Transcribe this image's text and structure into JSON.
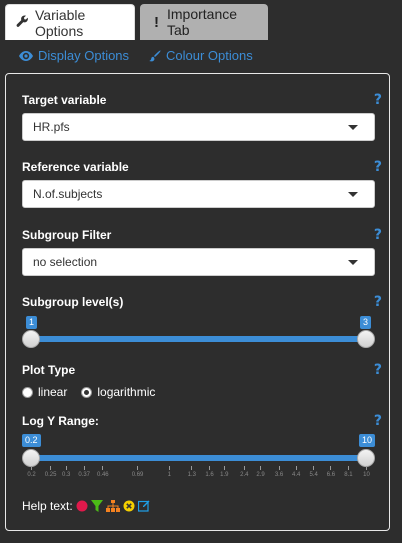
{
  "tabs": [
    {
      "label": "Variable Options",
      "icon": "wrench-icon"
    },
    {
      "label": "Importance Tab",
      "icon": "exclamation-icon"
    }
  ],
  "sublinks": {
    "display": "Display Options",
    "colour": "Colour Options"
  },
  "fields": {
    "target": {
      "label": "Target variable",
      "value": "HR.pfs"
    },
    "reference": {
      "label": "Reference variable",
      "value": "N.of.subjects"
    },
    "filter": {
      "label": "Subgroup Filter",
      "value": "no selection"
    }
  },
  "subgroup_levels": {
    "label": "Subgroup level(s)",
    "min_value": "1",
    "max_value": "3"
  },
  "plot_type": {
    "label": "Plot Type",
    "options": [
      "linear",
      "logarithmic"
    ],
    "selected": "logarithmic"
  },
  "log_y_range": {
    "label": "Log Y Range:",
    "min_value": "0.2",
    "max_value": "10",
    "tick_labels": [
      "0.2",
      "0.25",
      "0.3",
      "0.37",
      "0.46",
      "0.69",
      "1",
      "1.3",
      "1.6",
      "1.9",
      "2.4",
      "2.9",
      "3.6",
      "4.4",
      "5.4",
      "6.6",
      "8.1",
      "10"
    ]
  },
  "help": {
    "label": "Help text:",
    "icon_names": [
      "circle-red-icon",
      "filter-green-icon",
      "hierarchy-orange-icon",
      "close-yellow-icon",
      "edit-blue-icon"
    ]
  },
  "help_q": "?",
  "colors": {
    "accent": "#3c8dd6",
    "background": "#2d2d2d"
  }
}
